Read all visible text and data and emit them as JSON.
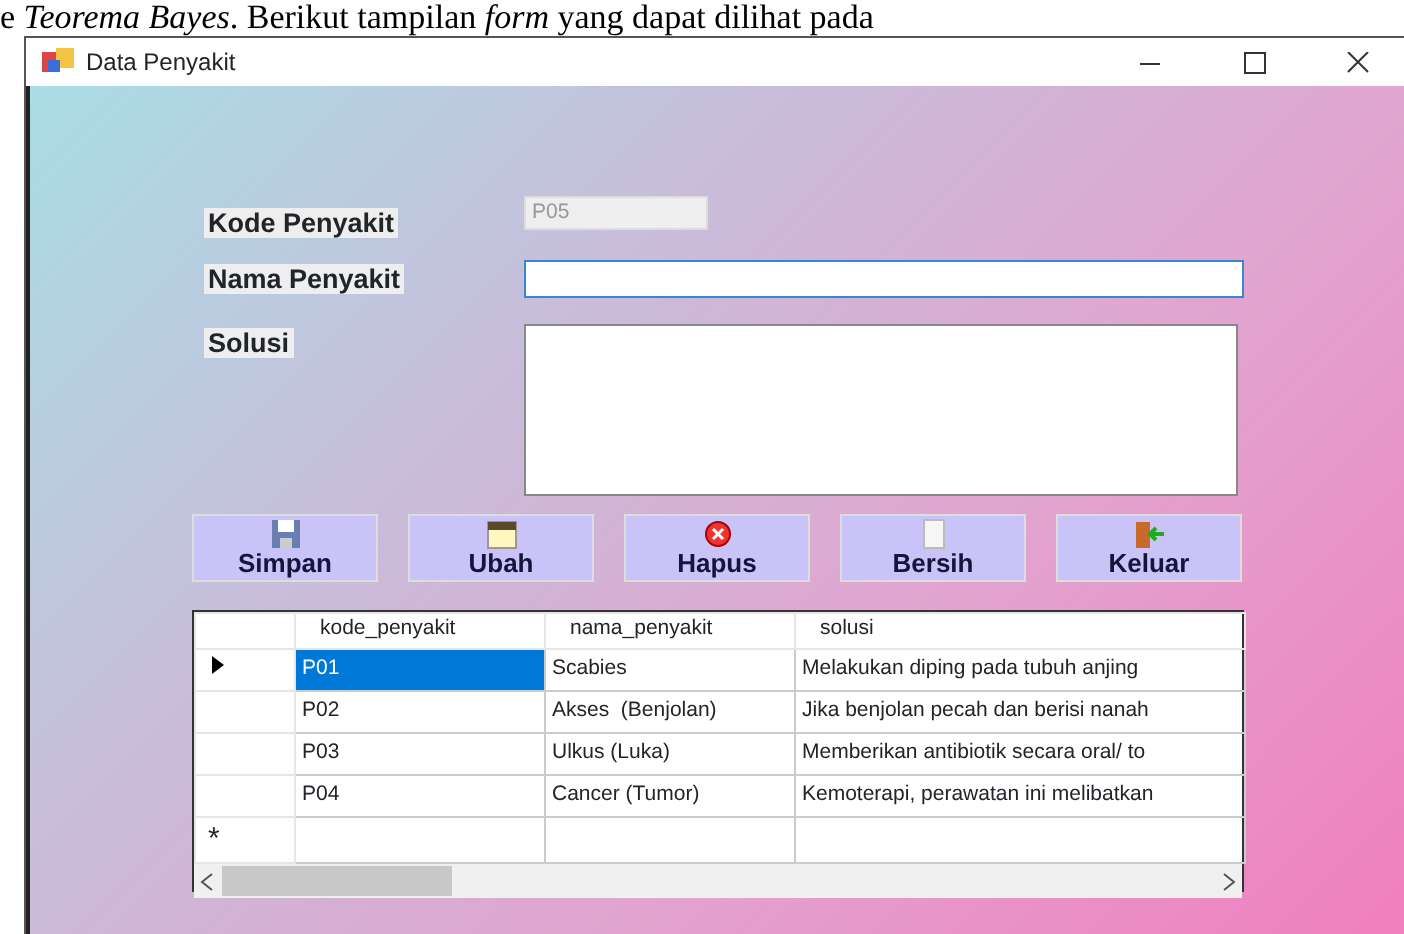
{
  "document_text": "e *Teorema Bayes*. Berikut tampilan *form*  yang dapat dilihat pada",
  "window": {
    "title": "Data Penyakit"
  },
  "fields": [
    {
      "label": "Kode Penyakit",
      "kind": "readonly",
      "value": "P05"
    },
    {
      "label": "Nama Penyakit",
      "kind": "text",
      "focused": true
    },
    {
      "label": "Solusi",
      "kind": "multiline",
      "focused": false
    }
  ],
  "buttons": [
    {
      "label": "Simpan",
      "kind": "save"
    },
    {
      "label": "Ubah",
      "kind": "edit"
    },
    {
      "label": "Hapus",
      "kind": "delete"
    },
    {
      "label": "Bersih",
      "kind": "clear"
    },
    {
      "label": "Keluar",
      "kind": "exit"
    }
  ],
  "table": {
    "columns": [
      "kode_penyakit",
      "nama_penyakit",
      "solusi"
    ],
    "rows": [
      {
        "current": true,
        "cells": [
          {
            "text": "P01",
            "selected": true
          },
          {
            "text": "Scabies",
            "selected": false
          },
          {
            "text": "Melakukan diping pada tubuh anjing",
            "selected": false
          }
        ]
      },
      {
        "current": false,
        "cells": [
          {
            "text": "P02",
            "selected": false
          },
          {
            "text": "Akses  (Benjolan)",
            "selected": false
          },
          {
            "text": "Jika benjolan pecah dan berisi nanah",
            "selected": false
          }
        ]
      },
      {
        "current": false,
        "cells": [
          {
            "text": "P03",
            "selected": false
          },
          {
            "text": "Ulkus (Luka)",
            "selected": false
          },
          {
            "text": "Memberikan antibiotik secara oral/ to",
            "selected": false
          }
        ]
      },
      {
        "current": false,
        "cells": [
          {
            "text": "P04",
            "selected": false
          },
          {
            "text": "Cancer (Tumor)",
            "selected": false
          },
          {
            "text": "Kemoterapi, perawatan ini melibatkan",
            "selected": false
          }
        ]
      }
    ],
    "new_row_marker": "*"
  }
}
